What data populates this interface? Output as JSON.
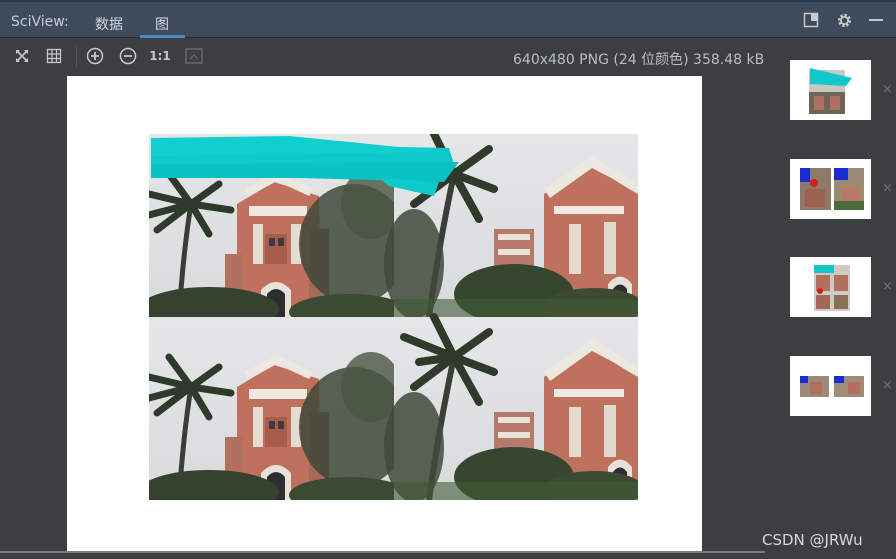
{
  "header": {
    "app_label": "SciView:",
    "tabs": [
      {
        "label": "数据",
        "active": false
      },
      {
        "label": "图",
        "active": true
      }
    ]
  },
  "toolbar": {
    "icons": [
      "fit-screen-icon",
      "grid-icon",
      "zoom-in-icon",
      "zoom-out-icon",
      "actual-size-icon",
      "fit-page-icon"
    ],
    "actual_size_label": "1:1",
    "image_info": "640x480 PNG (24 位颜色) 358.48 kB"
  },
  "thumbnails": {
    "count": 4,
    "close_glyph": "×"
  },
  "watermark": "CSDN @JRWu",
  "colors": {
    "titlebar": "#3d4b5c",
    "background": "#3c3f41",
    "tab_underline": "#4a88c7",
    "scribble": "#0ec9c9"
  }
}
